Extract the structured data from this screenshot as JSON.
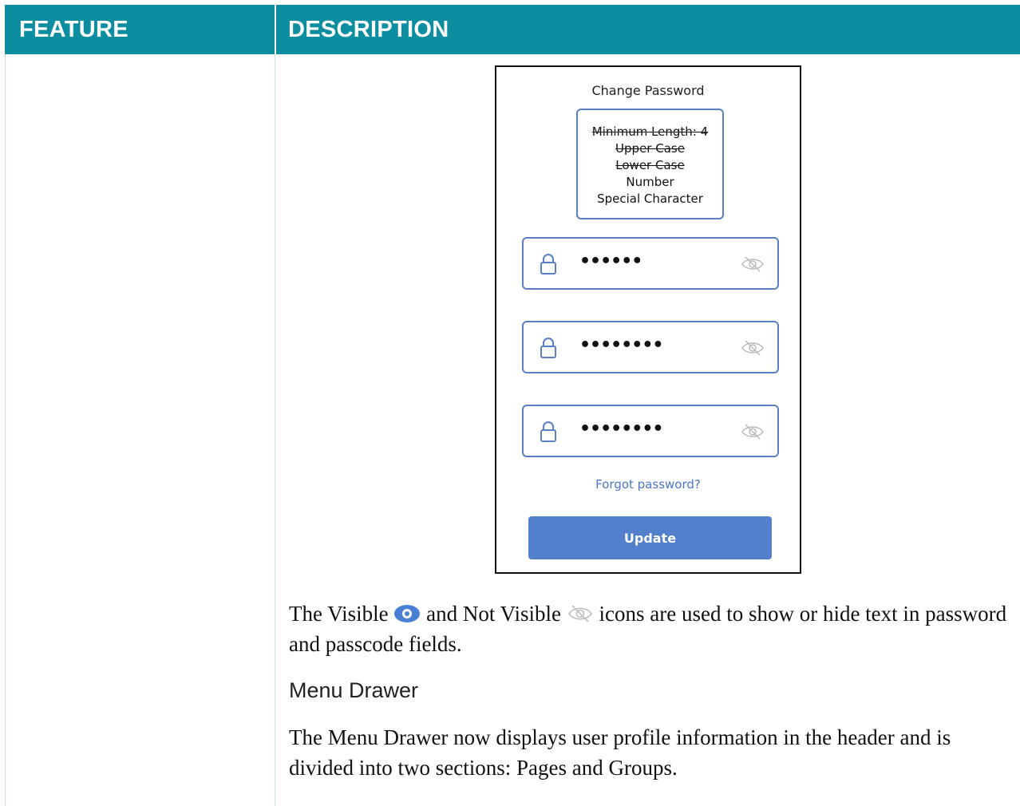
{
  "table": {
    "header": {
      "feature": "FEATURE",
      "description": "DESCRIPTION"
    }
  },
  "mockup": {
    "title": "Change Password",
    "rules": [
      {
        "text": "Minimum Length: 4",
        "satisfied": true
      },
      {
        "text": "Upper Case",
        "satisfied": true
      },
      {
        "text": "Lower Case",
        "satisfied": true
      },
      {
        "text": "Number",
        "satisfied": false
      },
      {
        "text": "Special Character",
        "satisfied": false
      }
    ],
    "fields": [
      {
        "value": "••••••"
      },
      {
        "value": "••••••••"
      },
      {
        "value": "••••••••"
      }
    ],
    "forgot_link": "Forgot password?",
    "update_button": "Update"
  },
  "description": {
    "para1_a": "The Visible",
    "para1_b": "and Not Visible",
    "para1_c": "icons are used to show or hide text in password and passcode fields.",
    "subheading": "Menu Drawer",
    "para2": "The Menu Drawer now displays user profile information in the header and is divided into two sections: Pages and Groups."
  },
  "colors": {
    "header_bg": "#0c8ea0",
    "field_border": "#5a7fc4",
    "button_bg": "#5280cd",
    "link": "#4a78c8"
  }
}
